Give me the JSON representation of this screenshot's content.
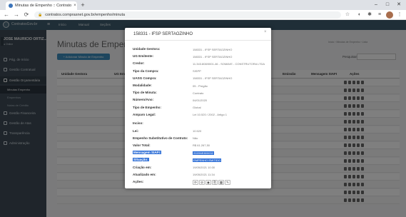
{
  "browser": {
    "tab_title": "Minutas de Empenho :: Contrato",
    "tab_close": "×",
    "new_tab": "+",
    "url": "contratos.comprasnet.gov.br/empenho/minuta",
    "back": "←",
    "forward": "→",
    "reload": "⟳",
    "lock": "🔒",
    "minimize": "–",
    "maximize": "□",
    "close": "✕",
    "star": "☆",
    "ext1": "◐",
    "ext2": "✱",
    "ext3": "≡",
    "menu": "⋮"
  },
  "app": {
    "brand": "ContratosGov.br",
    "hamburger": "≡",
    "topnav": [
      "Início",
      "Manual",
      "Seções"
    ],
    "user_name": "JOSE MAURICIO ORTIZ...",
    "user_status": "● Online",
    "page_title": "Minutas de Empenho",
    "breadcrumb": "Início › Minutas de Empenho › Lista",
    "add_button": "+ Adicionar Minuta de Empenho",
    "search_label": "Pesquisar:",
    "sidebar": [
      {
        "label": "Pág. de Início"
      },
      {
        "label": "Gestão Contratual"
      },
      {
        "label": "Gestão Orçamentária"
      },
      {
        "label": "Minutas Empenho"
      },
      {
        "label": "Empenhos"
      },
      {
        "label": "Notas de Crédito"
      },
      {
        "label": "Gestão Financeira"
      },
      {
        "label": "Gestão de Atas"
      },
      {
        "label": "Transparência"
      },
      {
        "label": "Administração"
      }
    ],
    "table_headers": [
      "Unidade Gestora",
      "UG Emitente",
      "Núm.",
      "Emissão",
      "Mensagem SIAFI",
      "Ações"
    ]
  },
  "modal": {
    "title": "158331 - IFSP SERTAOZINHO",
    "close": "×",
    "fields": [
      {
        "label": "Unidade Gestora:",
        "value": "158331 - IFSP SERTAOZINHO",
        "highlight": false
      },
      {
        "label": "UG Emitente:",
        "value": "158331 - IFSP SERTAOZINHO",
        "highlight": false
      },
      {
        "label": "Credor:",
        "value": "11.343.808/0001-46 - SOMAVE - CONSTRUTORA LTDA",
        "highlight": false
      },
      {
        "label": "Tipo da Compra:",
        "value": "SISPP",
        "highlight": false
      },
      {
        "label": "UASG Compra:",
        "value": "158331 - IFSP SERTAOZINHO",
        "highlight": false
      },
      {
        "label": "Modalidade:",
        "value": "05 - Pregão",
        "highlight": false
      },
      {
        "label": "Tipo de Minuta:",
        "value": "Contrato",
        "highlight": false
      },
      {
        "label": "Número/Ano:",
        "value": "04/01/2020",
        "highlight": false
      },
      {
        "label": "Tipo de Empenho:",
        "value": "Global",
        "highlight": false
      },
      {
        "label": "Amparo Legal:",
        "value": "Lei 10.520 / 2002 - Artigo 1",
        "highlight": false
      },
      {
        "label": "Inciso:",
        "value": "",
        "highlight": false
      },
      {
        "label": "Lei:",
        "value": "10.520",
        "highlight": false
      },
      {
        "label": "Empenho Substitutivo de Contrato:",
        "value": "Não",
        "highlight": false
      },
      {
        "label": "Valor Total:",
        "value": "R$ 61.267,50",
        "highlight": false
      },
      {
        "label": "Mensagem SIAFI:",
        "value": "2020NE800032",
        "highlight": true
      },
      {
        "label": "Situação:",
        "value": "EMPENHO EMITIDO",
        "highlight": true
      },
      {
        "label": "Criação em:",
        "value": "19/05/2021 10:30",
        "highlight": false
      },
      {
        "label": "Atualizado em:",
        "value": "19/05/2021 11:34",
        "highlight": false
      },
      {
        "label": "Ações:",
        "value": "",
        "highlight": false
      }
    ],
    "actions": [
      "⟳",
      "⊘",
      "◉",
      "⎘",
      "▦",
      "✎"
    ]
  }
}
